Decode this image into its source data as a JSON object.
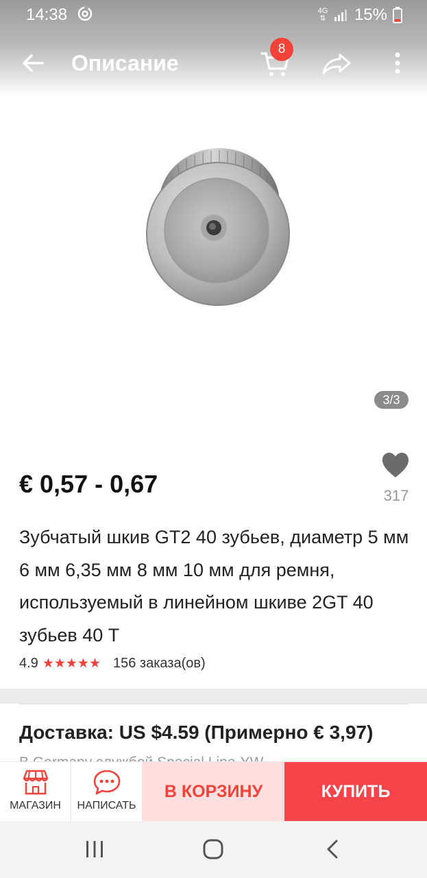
{
  "status_bar": {
    "time": "14:38",
    "network": "4G",
    "battery": "15%"
  },
  "app_bar": {
    "title": "Описание",
    "cart_count": "8",
    "icons": [
      "back-arrow-icon",
      "cart-icon",
      "share-icon",
      "more-vert-icon"
    ]
  },
  "gallery": {
    "page_indicator": "3/3"
  },
  "product": {
    "price": "€ 0,57 - 0,67",
    "wishlist_count": "317",
    "title": "Зубчатый шкив GT2 40 зубьев, диаметр 5 мм 6 мм 6,35 мм 8 мм 10 мм для ремня, используемый в линейном шкиве 2GT 40 зубьев 40 T",
    "rating": "4.9",
    "stars": "★★★★★",
    "orders": "156 заказа(ов)"
  },
  "shipping": {
    "title": "Доставка: US $4.59 (Примерно € 3,97)",
    "subtitle": "В Germany службой Special Line-YW"
  },
  "actions": {
    "store_label": "МАГАЗИН",
    "message_label": "НАПИСАТЬ",
    "add_to_cart_label": "В КОРЗИНУ",
    "buy_label": "КУПИТЬ"
  },
  "colors": {
    "accent": "#f2423a",
    "buy_button": "#f7434a",
    "cart_button_bg": "#ffdede"
  }
}
